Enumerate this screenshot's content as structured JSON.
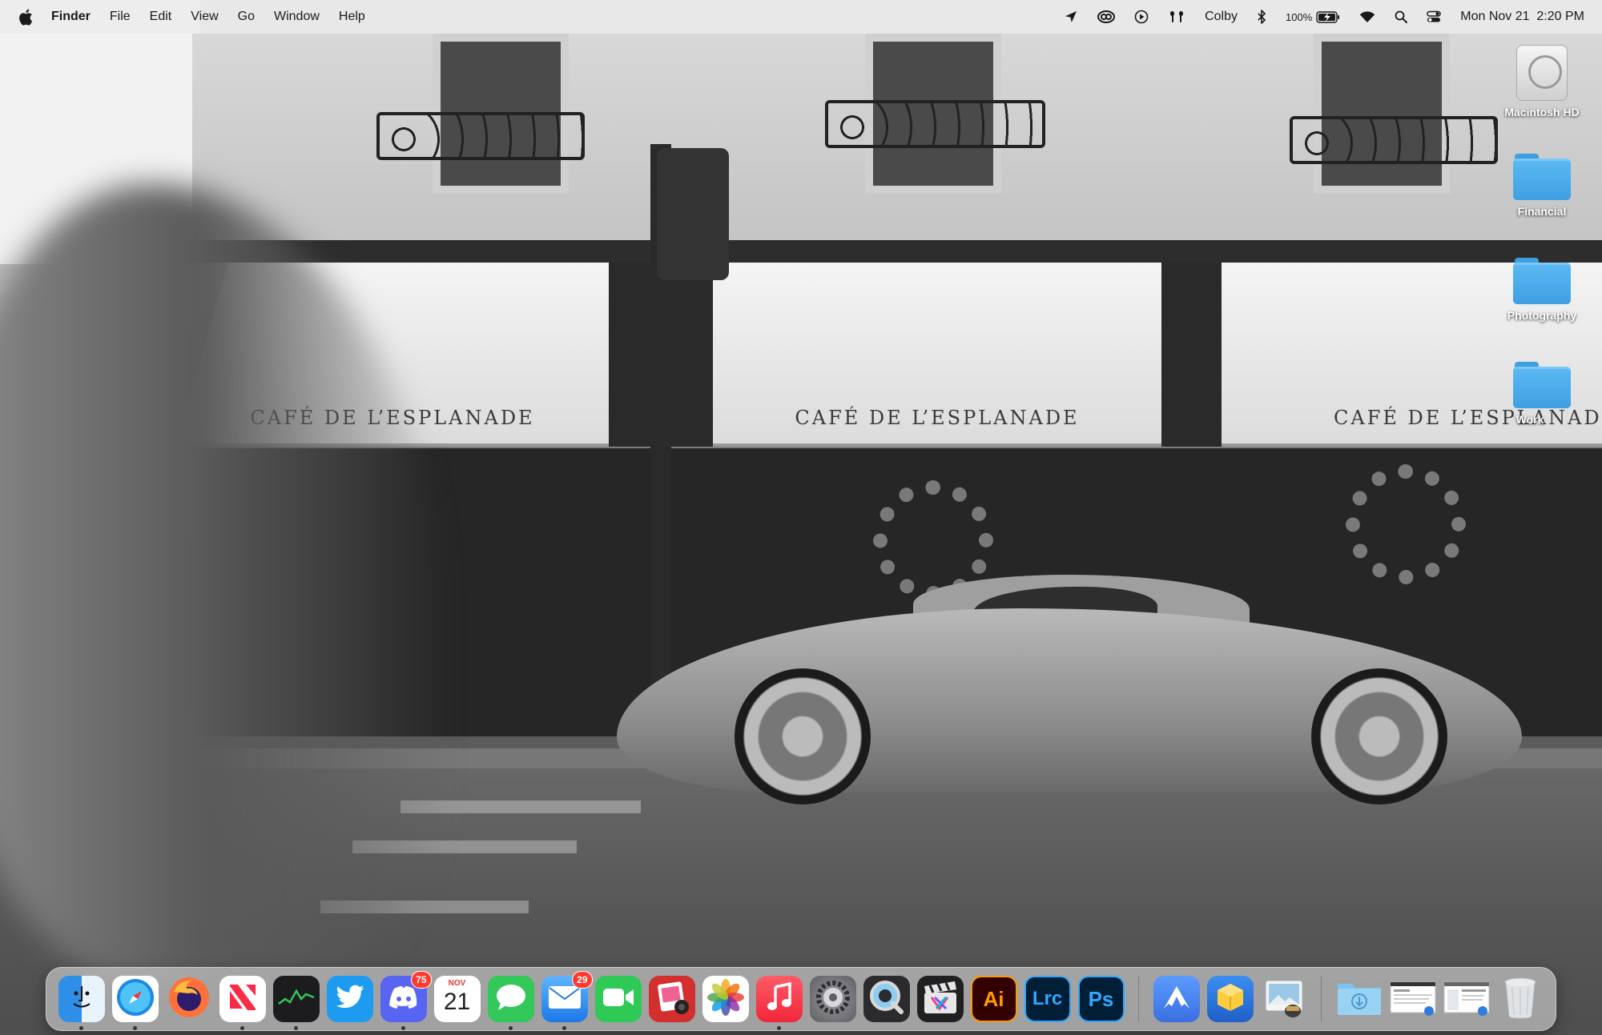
{
  "menubar": {
    "app_name": "Finder",
    "menus": [
      "File",
      "Edit",
      "View",
      "Go",
      "Window",
      "Help"
    ],
    "status": {
      "user": "Colby",
      "battery_percent": "100%",
      "datetime": "Mon Nov 21  2:20 PM"
    }
  },
  "wallpaper": {
    "signs": [
      "CAFÉ DE L’ESPLANADE",
      "CAFÉ DE L’ESPLANADE",
      "CAFÉ DE L’ESPLANAD"
    ]
  },
  "desktop": {
    "items": [
      {
        "label": "Macintosh HD",
        "icon": "hard-drive-icon"
      },
      {
        "label": "Financial",
        "icon": "folder-icon"
      },
      {
        "label": "Photography",
        "icon": "folder-icon"
      },
      {
        "label": "Work",
        "icon": "folder-icon"
      }
    ]
  },
  "dock": {
    "apps": [
      {
        "name": "finder",
        "icon": "finder-icon",
        "bg": "#2f8fe8",
        "running": true
      },
      {
        "name": "safari",
        "icon": "safari-icon",
        "bg": "#ffffff",
        "running": true
      },
      {
        "name": "firefox",
        "icon": "firefox-icon",
        "bg": "#1b1f6b",
        "running": false
      },
      {
        "name": "news",
        "icon": "news-icon",
        "bg": "#ffffff",
        "running": true
      },
      {
        "name": "stocks",
        "icon": "stocks-icon",
        "bg": "#1c1c1e",
        "running": true
      },
      {
        "name": "twitter",
        "icon": "twitter-icon",
        "bg": "#1d9bf0",
        "running": false
      },
      {
        "name": "discord",
        "icon": "discord-icon",
        "bg": "#5865f2",
        "running": true,
        "badge": "75"
      },
      {
        "name": "calendar",
        "icon": "calendar-icon",
        "bg": "#ffffff",
        "running": false,
        "month": "NOV",
        "day": "21"
      },
      {
        "name": "messages",
        "icon": "messages-icon",
        "bg": "#34c759",
        "running": true
      },
      {
        "name": "mail",
        "icon": "mail-icon",
        "bg": "#3b8ef0",
        "running": true,
        "badge": "29"
      },
      {
        "name": "facetime",
        "icon": "facetime-icon",
        "bg": "#2fc956",
        "running": false
      },
      {
        "name": "photo-booth",
        "icon": "photo-booth-icon",
        "bg": "#d32f2f",
        "running": false
      },
      {
        "name": "photos",
        "icon": "photos-icon",
        "bg": "#ffffff",
        "running": false
      },
      {
        "name": "music",
        "icon": "music-icon",
        "bg": "#fc3c44",
        "running": true
      },
      {
        "name": "system-settings",
        "icon": "gear-icon",
        "bg": "#6f6f74",
        "running": false
      },
      {
        "name": "quicktime",
        "icon": "quicktime-icon",
        "bg": "#2b2b2e",
        "running": false
      },
      {
        "name": "final-cut-pro",
        "icon": "clapper-icon",
        "bg": "#202022",
        "running": false
      },
      {
        "name": "illustrator",
        "icon": "illustrator-icon",
        "bg": "#330000",
        "running": false,
        "text": "Ai",
        "fg": "#ff9a00"
      },
      {
        "name": "lightroom-classic",
        "icon": "lightroom-icon",
        "bg": "#001e36",
        "running": false,
        "text": "Lrc",
        "fg": "#31a8ff"
      },
      {
        "name": "photoshop",
        "icon": "photoshop-icon",
        "bg": "#001e36",
        "running": false,
        "text": "Ps",
        "fg": "#31a8ff"
      }
    ],
    "utilities": [
      {
        "name": "nordvpn",
        "icon": "nordvpn-icon",
        "bg": "#4687ff",
        "running": false
      },
      {
        "name": "keka",
        "icon": "box-icon",
        "bg": "#1f6fd6",
        "running": false
      },
      {
        "name": "preview",
        "icon": "preview-icon",
        "bg": "#cfd8df",
        "running": false
      }
    ],
    "stacks": [
      {
        "name": "downloads-stack",
        "icon": "downloads-folder-icon"
      },
      {
        "name": "screenshot-stack-1",
        "icon": "screenshot-icon"
      },
      {
        "name": "screenshot-stack-2",
        "icon": "screenshot-icon"
      },
      {
        "name": "trash",
        "icon": "trash-icon"
      }
    ]
  }
}
